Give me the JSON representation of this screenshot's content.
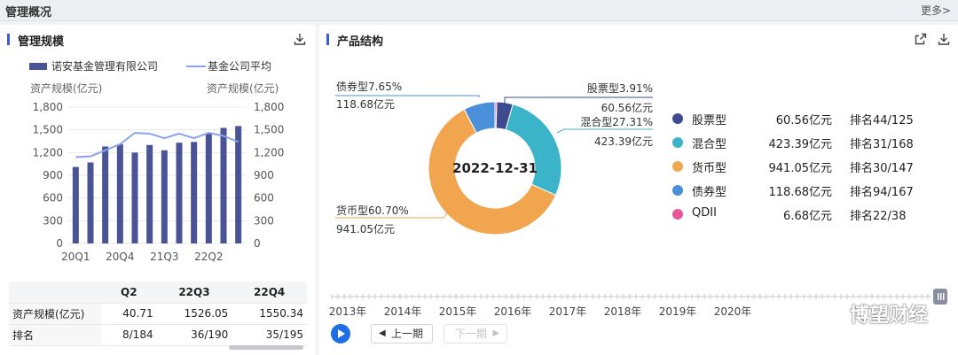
{
  "header": {
    "title": "管理概况",
    "more": "更多>"
  },
  "scale_panel": {
    "title": "管理规模",
    "legend_bar": "诺安基金管理有限公司",
    "legend_line": "基金公司平均",
    "ylabel_left": "资产规模(亿元)",
    "ylabel_right": "资产规模(亿元)"
  },
  "table": {
    "headers": [
      "Q2",
      "22Q3",
      "22Q4"
    ],
    "rows": [
      {
        "label": "资产规模(亿元)",
        "cells": [
          "40.71",
          "1526.05",
          "1550.34"
        ]
      },
      {
        "label": "排名",
        "cells": [
          "8/184",
          "36/190",
          "35/195"
        ]
      }
    ]
  },
  "structure_panel": {
    "title": "产品结构",
    "center_date": "2022-12-31",
    "items": [
      {
        "name": "股票型",
        "amount": "60.56亿元",
        "rank": "排名44/125",
        "color": "#3d4a8f"
      },
      {
        "name": "混合型",
        "amount": "423.39亿元",
        "rank": "排名31/168",
        "color": "#3bb4c9"
      },
      {
        "name": "货币型",
        "amount": "941.05亿元",
        "rank": "排名30/147",
        "color": "#f2a54f"
      },
      {
        "name": "债券型",
        "amount": "118.68亿元",
        "rank": "排名94/167",
        "color": "#4a8fd9"
      },
      {
        "name": "QDII",
        "amount": "6.68亿元",
        "rank": "排名22/38",
        "color": "#e8559b"
      }
    ],
    "labels": {
      "stock": {
        "pct": "股票型3.91%",
        "amt": "60.56亿元"
      },
      "mixed": {
        "pct": "混合型27.31%",
        "amt": "423.39亿元"
      },
      "money": {
        "pct": "货币型60.70%",
        "amt": "941.05亿元"
      },
      "bond": {
        "pct": "债券型7.65%",
        "amt": "118.68亿元"
      }
    },
    "timeline_years": [
      "2013年",
      "2014年",
      "2015年",
      "2016年",
      "2017年",
      "2018年",
      "2019年",
      "2020年"
    ],
    "prev_label": "上一期",
    "next_label": "下一期"
  },
  "watermark": "博望财经",
  "chart_data": [
    {
      "type": "bar",
      "title": "",
      "categories": [
        "20Q1",
        "20Q2",
        "20Q3",
        "20Q4",
        "21Q1",
        "21Q2",
        "21Q3",
        "21Q4",
        "22Q1",
        "22Q2",
        "22Q3",
        "22Q4"
      ],
      "x_tick_labels": [
        "20Q1",
        "20Q4",
        "21Q3",
        "22Q2"
      ],
      "series": [
        {
          "name": "诺安基金管理有限公司",
          "type": "bar",
          "values": [
            1010,
            1070,
            1280,
            1310,
            1200,
            1300,
            1230,
            1330,
            1340,
            1450,
            1526.05,
            1550.34
          ],
          "color": "#4a5396"
        },
        {
          "name": "基金公司平均",
          "type": "line",
          "values": [
            1140,
            1150,
            1230,
            1310,
            1460,
            1450,
            1390,
            1450,
            1390,
            1460,
            1420,
            1340
          ],
          "color": "#8aa3f0"
        }
      ],
      "ylabel": "资产规模(亿元)",
      "y_ticks": [
        "0",
        "300",
        "600",
        "900",
        "1,200",
        "1,500",
        "1,800"
      ],
      "ylim": [
        0,
        1800
      ]
    },
    {
      "type": "pie",
      "title": "",
      "categories": [
        "股票型",
        "混合型",
        "货币型",
        "债券型",
        "QDII"
      ],
      "values": [
        60.56,
        423.39,
        941.05,
        118.68,
        6.68
      ],
      "percent": [
        3.91,
        27.31,
        60.7,
        7.65,
        0.43
      ],
      "colors": [
        "#3d4a8f",
        "#3bb4c9",
        "#f2a54f",
        "#4a8fd9",
        "#e8559b"
      ]
    }
  ]
}
